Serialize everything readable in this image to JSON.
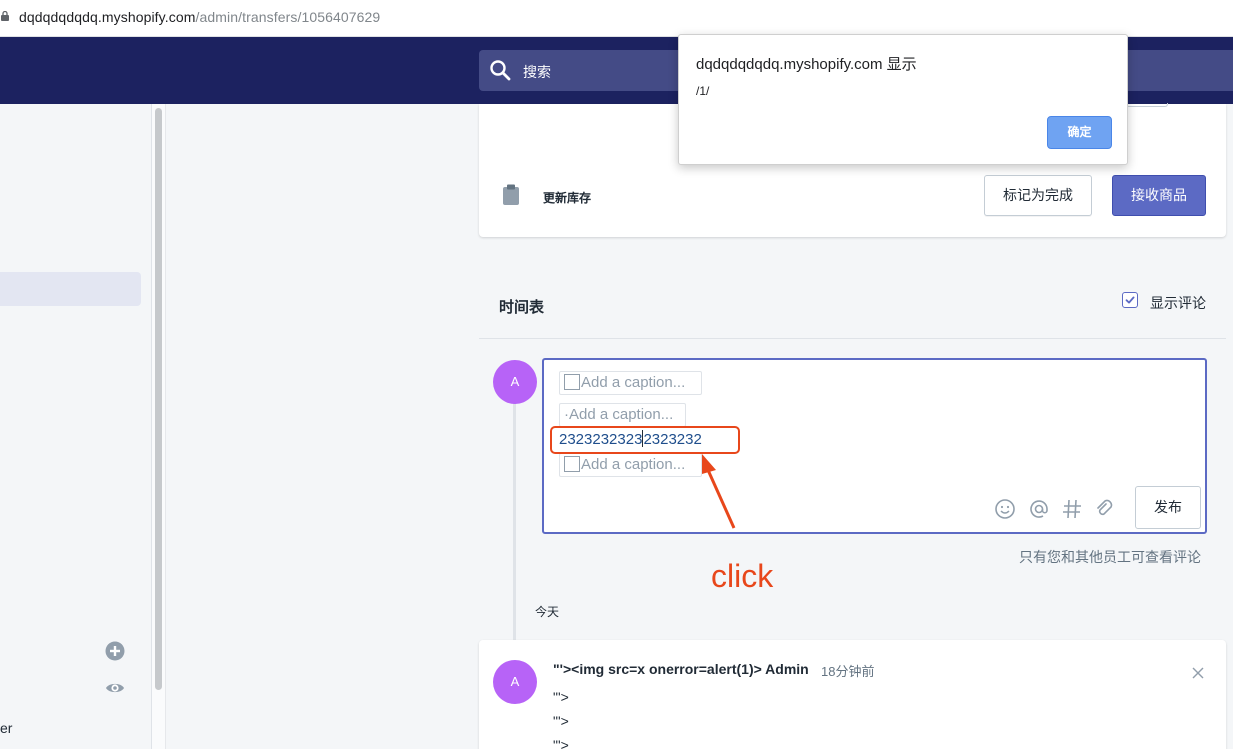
{
  "browser": {
    "url_host": "dqdqdqdqdq.myshopify.com",
    "url_path": "/admin/transfers/1056407629"
  },
  "topnav": {
    "search_placeholder": "搜索"
  },
  "sidebar": {
    "partial_label": "er"
  },
  "inventory_card": {
    "update_label": "更新库存",
    "mark_complete_label": "标记为完成",
    "receive_goods_label": "接收商品"
  },
  "timeline": {
    "title": "时间表",
    "show_comments_label": "显示评论",
    "show_comments_checked": true
  },
  "editor": {
    "avatar_initial": "A",
    "captions": [
      "Add a caption...",
      "·Add a caption...",
      "Add a caption..."
    ],
    "typed_before_caret": "2323232323",
    "typed_after_caret": "2323232",
    "post_label": "发布",
    "tool_icons": [
      "emoji-icon",
      "mention-icon",
      "hashtag-icon",
      "attachment-icon"
    ]
  },
  "annotation": {
    "note": "click",
    "color": "#e8471b"
  },
  "visibility_note": "只有您和其他员工可查看评论",
  "date_group": "今天",
  "comment": {
    "avatar_initial": "A",
    "author": "\"'><img src=x onerror=alert(1)> Admin",
    "time": "18分钟前",
    "lines": [
      "\"'>",
      "\"'>",
      "\"'>"
    ]
  },
  "dialog": {
    "title": "dqdqdqdqdq.myshopify.com 显示",
    "message": "/1/",
    "ok_label": "确定"
  },
  "colors": {
    "nav": "#1c2260",
    "primary": "#5c6ac4",
    "avatar": "#b763f7"
  }
}
